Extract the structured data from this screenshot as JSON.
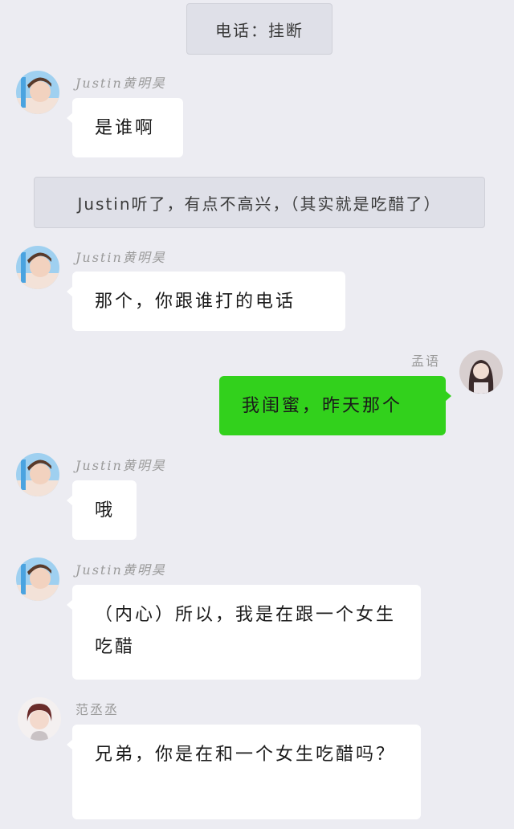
{
  "messages": {
    "sys1": "电话：挂断",
    "justin_name": "Justin黄明昊",
    "m1": "是谁啊",
    "sys2": "Justin听了，有点不高兴，（其实就是吃醋了）",
    "m2": "那个，你跟谁打的电话",
    "me_name": "孟语",
    "m3": "我闺蜜，昨天那个",
    "m4": "哦",
    "m5": "（内心）所以，我是在跟一个女生吃醋",
    "fan_name": "范丞丞",
    "m6": "兄弟，你是在和一个女生吃醋吗？"
  },
  "colors": {
    "background": "#ececf2",
    "my_bubble": "#32d11c",
    "other_bubble": "#ffffff",
    "system_pill": "#dfe0e8"
  }
}
